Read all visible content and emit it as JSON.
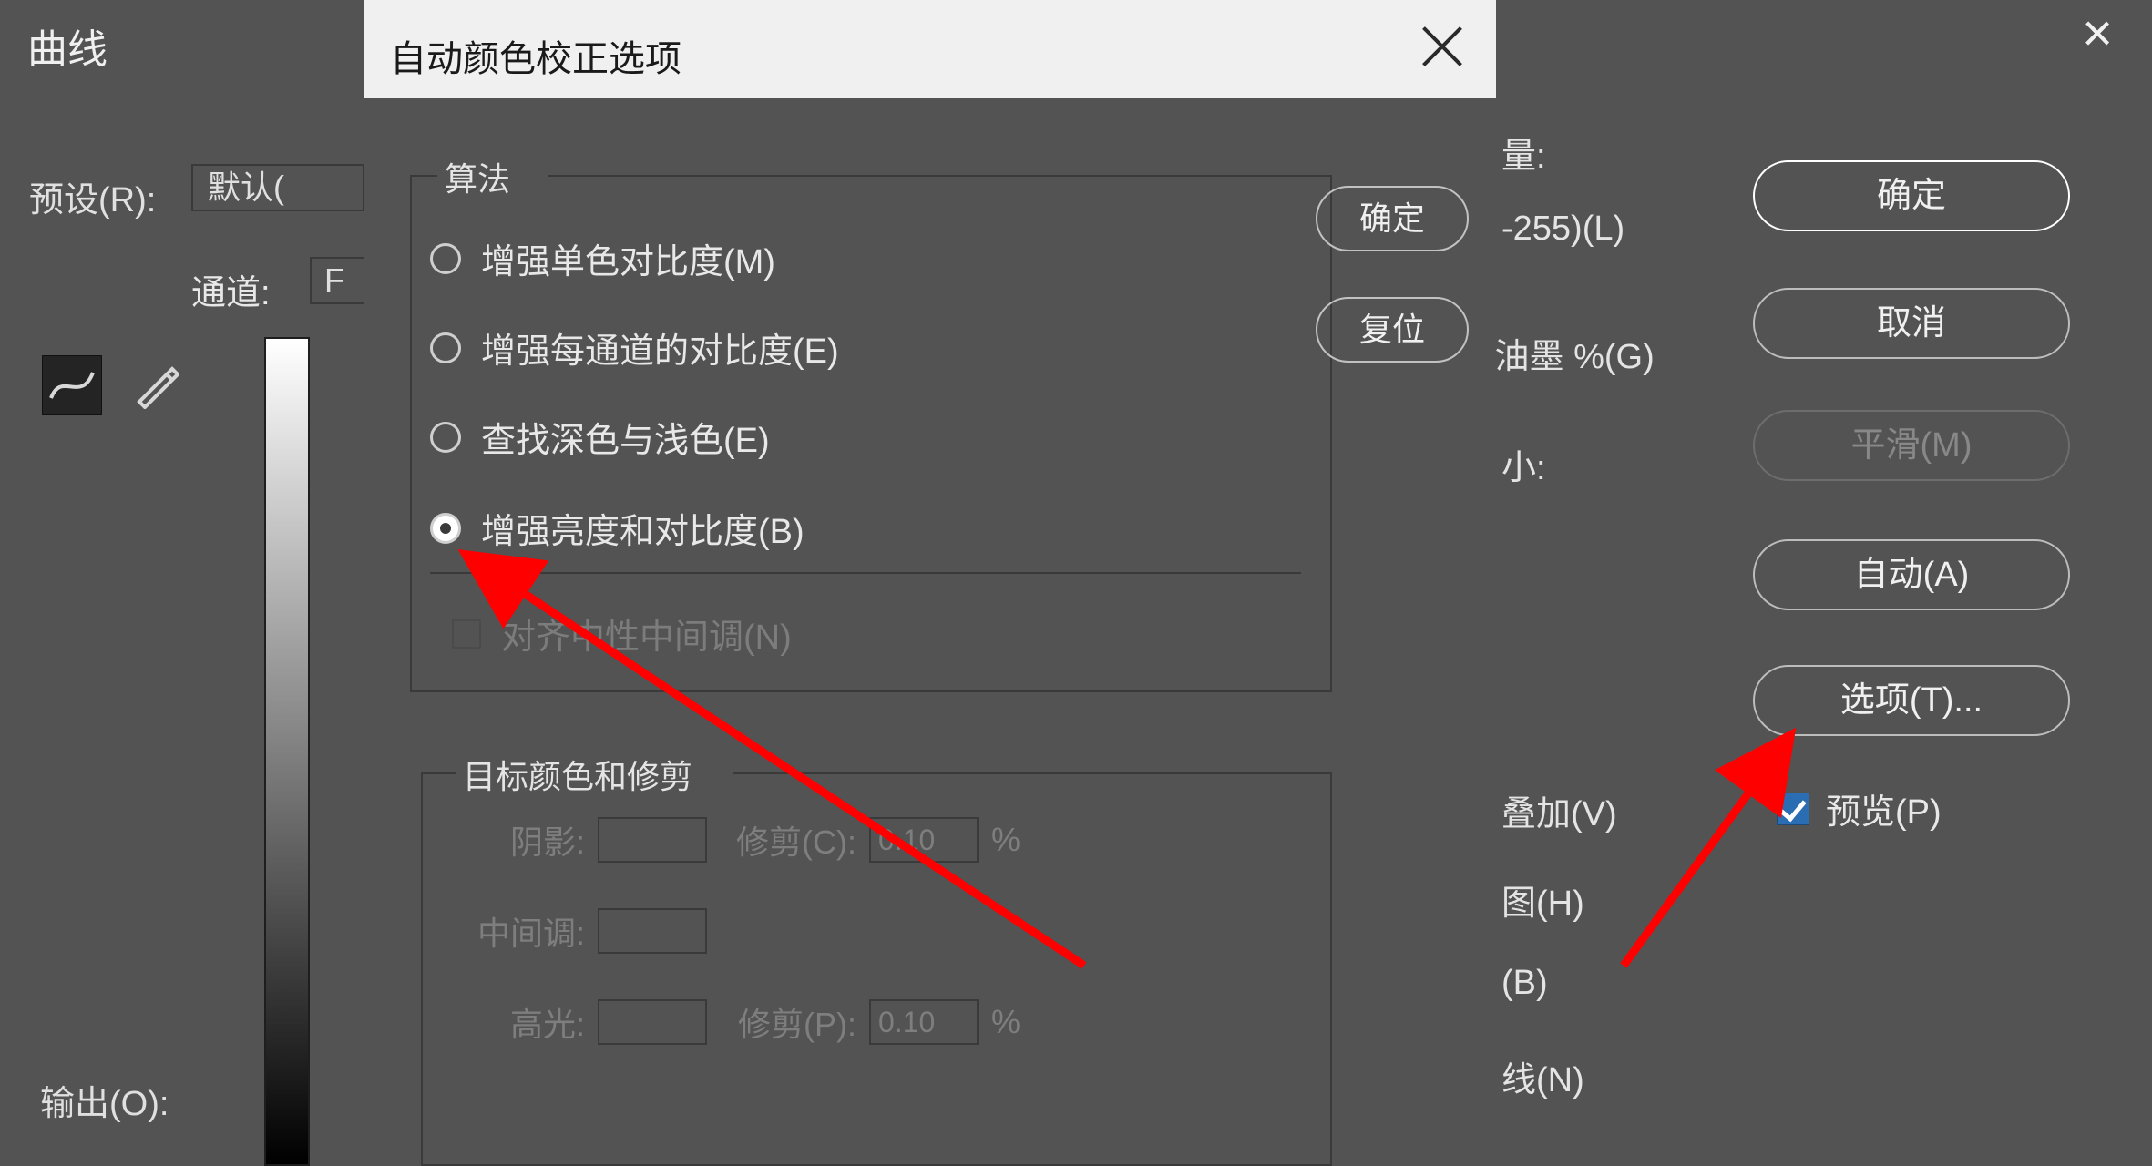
{
  "curves": {
    "title": "曲线",
    "preset_label": "预设(R):",
    "preset_value": "默认(",
    "channel_label": "通道:",
    "channel_value": "F",
    "output_label": "输出(O):",
    "right_partial_1": "量:",
    "right_partial_2": "-255)(L)",
    "right_partial_3": "/油墨 %(G)",
    "right_partial_4": "小:",
    "right_partial_5": "叠加(V)",
    "right_partial_6": "图(H)",
    "right_partial_7": "(B)",
    "right_partial_8": "线(N)",
    "buttons": {
      "ok": "确定",
      "cancel": "取消",
      "smooth": "平滑(M)",
      "auto": "自动(A)",
      "options": "选项(T)..."
    },
    "preview_label": "预览(P)"
  },
  "auto": {
    "title": "自动颜色校正选项",
    "algorithm_label": "算法",
    "alg_options": {
      "mono": "增强单色对比度(M)",
      "per_channel": "增强每通道的对比度(E)",
      "find_dark_light": "查找深色与浅色(E)",
      "brightness_contrast": "增强亮度和对比度(B)"
    },
    "snap_neutral": "对齐中性中间调(N)",
    "target_label": "目标颜色和修剪",
    "shadow_label": "阴影:",
    "midtone_label": "中间调:",
    "highlight_label": "高光:",
    "clip_c_label": "修剪(C):",
    "clip_p_label": "修剪(P):",
    "clip_c_value": "0.10",
    "clip_p_value": "0.10",
    "percent": "%",
    "ok": "确定",
    "reset": "复位"
  }
}
